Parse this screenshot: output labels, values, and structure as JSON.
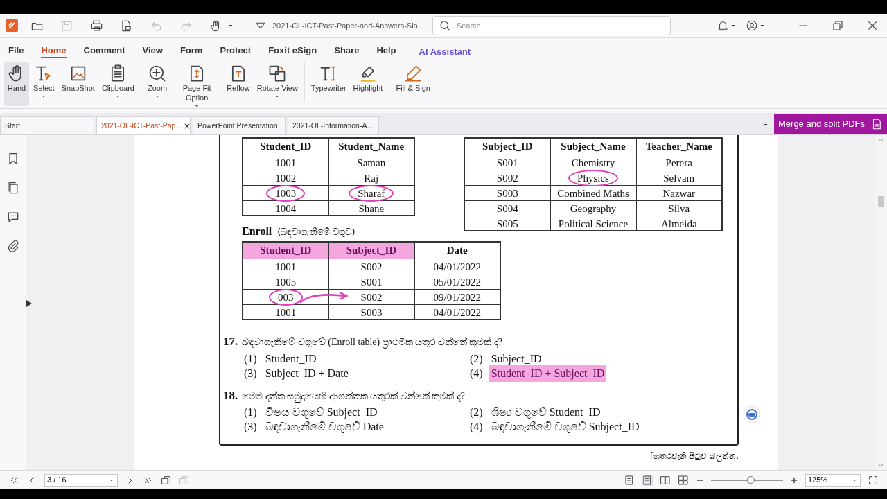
{
  "title_bar": {
    "file_title": "2021-OL-ICT-Past-Paper-and-Answers-Sin...",
    "search": {
      "placeholder": "Search"
    }
  },
  "menu": [
    {
      "label": "File",
      "selected": false
    },
    {
      "label": "Home",
      "selected": true
    },
    {
      "label": "Comment",
      "selected": false
    },
    {
      "label": "View",
      "selected": false
    },
    {
      "label": "Form",
      "selected": false
    },
    {
      "label": "Protect",
      "selected": false
    },
    {
      "label": "Foxit eSign",
      "selected": false
    },
    {
      "label": "Share",
      "selected": false
    },
    {
      "label": "Help",
      "selected": false
    },
    {
      "label": "AI Assistant",
      "selected": false,
      "kind": "accent"
    }
  ],
  "ribbon": [
    {
      "label": "Hand",
      "selected": true,
      "dropdown": false
    },
    {
      "label": "Select",
      "selected": false,
      "dropdown": true
    },
    {
      "label": "SnapShot",
      "selected": false,
      "dropdown": false
    },
    {
      "label": "Clipboard",
      "selected": false,
      "dropdown": true
    },
    {
      "label": "Zoom",
      "selected": false,
      "dropdown": true
    },
    {
      "label": "Page Fit Option",
      "selected": false,
      "dropdown": true
    },
    {
      "label": "Reflow",
      "selected": false,
      "dropdown": false
    },
    {
      "label": "Rotate View",
      "selected": false,
      "dropdown": true
    },
    {
      "label": "Typewriter",
      "selected": false,
      "dropdown": false
    },
    {
      "label": "Highlight",
      "selected": false,
      "dropdown": false
    },
    {
      "label": "Fill & Sign",
      "selected": false,
      "dropdown": false
    }
  ],
  "doc_tabs": [
    {
      "label": "Start",
      "selected": false,
      "closable": false
    },
    {
      "label": "2021-OL-ICT-Past-Pap...",
      "selected": true,
      "closable": true
    },
    {
      "label": "PowerPoint Presentation",
      "selected": false,
      "closable": false
    },
    {
      "label": "2021-OL-Information-A...",
      "selected": false,
      "closable": false
    }
  ],
  "promo_button": "Merge and split PDFs",
  "document": {
    "student_table": {
      "columns": [
        {
          "label": "Student_ID",
          "highlighted": false
        },
        {
          "label": "Student_Name",
          "highlighted": false
        }
      ],
      "rows": [
        [
          {
            "text": "1001",
            "circled": false
          },
          {
            "text": "Saman",
            "circled": false
          }
        ],
        [
          {
            "text": "1002",
            "circled": false
          },
          {
            "text": "Raj",
            "circled": false
          }
        ],
        [
          {
            "text": "1003",
            "circled": true
          },
          {
            "text": "Sharaf",
            "circled": true
          }
        ],
        [
          {
            "text": "1004",
            "circled": false
          },
          {
            "text": "Shane",
            "circled": false
          }
        ]
      ]
    },
    "subject_table": {
      "columns": [
        {
          "label": "Subject_ID",
          "highlighted": false
        },
        {
          "label": "Subject_Name",
          "highlighted": false
        },
        {
          "label": "Teacher_Name",
          "highlighted": false
        }
      ],
      "rows": [
        [
          {
            "text": "S001",
            "circled": false
          },
          {
            "text": "Chemistry",
            "circled": false
          },
          {
            "text": "Perera",
            "circled": false
          }
        ],
        [
          {
            "text": "S002",
            "circled": false
          },
          {
            "text": "Physics",
            "circled": true
          },
          {
            "text": "Selvam",
            "circled": false
          }
        ],
        [
          {
            "text": "S003",
            "circled": false
          },
          {
            "text": "Combined Maths",
            "circled": false
          },
          {
            "text": "Nazwar",
            "circled": false
          }
        ],
        [
          {
            "text": "S004",
            "circled": false
          },
          {
            "text": "Geography",
            "circled": false
          },
          {
            "text": "Silva",
            "circled": false
          }
        ],
        [
          {
            "text": "S005",
            "circled": false
          },
          {
            "text": "Political Science",
            "circled": false
          },
          {
            "text": "Almeida",
            "circled": false
          }
        ]
      ]
    },
    "enroll_title": "Enroll",
    "enroll_subtitle": "(බඳවාගැනීමේ වගුව)",
    "enroll_table": {
      "columns": [
        {
          "label": "Student_ID",
          "highlighted": true
        },
        {
          "label": "Subject_ID",
          "highlighted": true
        },
        {
          "label": "Date",
          "highlighted": false
        }
      ],
      "rows": [
        [
          {
            "text": "1001",
            "circled": false
          },
          {
            "text": "S002",
            "circled": false
          },
          {
            "text": "04/01/2022",
            "circled": false
          }
        ],
        [
          {
            "text": "1005",
            "circled": false
          },
          {
            "text": "S001",
            "circled": false
          },
          {
            "text": "05/01/2022",
            "circled": false
          }
        ],
        [
          {
            "text": "003",
            "circled": true
          },
          {
            "text": "S002",
            "circled": false
          },
          {
            "text": "09/01/2022",
            "circled": false
          }
        ],
        [
          {
            "text": "1001",
            "circled": false
          },
          {
            "text": "S003",
            "circled": false
          },
          {
            "text": "04/01/2022",
            "circled": false
          }
        ]
      ]
    },
    "questions": [
      {
        "number": "17.",
        "text": "බඳවාගැනීමේ වගුවේ (Enroll table) ප්‍රාථමික යතුර වන්නේ කුමක් ද?",
        "options": [
          {
            "number": "(1)",
            "text": "Student_ID",
            "highlighted": false
          },
          {
            "number": "(2)",
            "text": "Subject_ID",
            "highlighted": false
          },
          {
            "number": "(3)",
            "text": "Subject_ID + Date",
            "highlighted": false
          },
          {
            "number": "(4)",
            "text": "Student_ID + Subject_ID",
            "highlighted": true
          }
        ]
      },
      {
        "number": "18.",
        "text": "මෙම දත්ත සමුදායෙහි ආගන්තුක යතුරක් වන්නේ කුමක් ද?",
        "options": [
          {
            "number": "(1)",
            "text": "විෂය වගුවේ Subject_ID",
            "highlighted": false
          },
          {
            "number": "(2)",
            "text": "ශිෂ්‍ය වගුවේ Student_ID",
            "highlighted": false
          },
          {
            "number": "(3)",
            "text": "බඳවාගැනීමේ වගුවේ Date",
            "highlighted": false
          },
          {
            "number": "(4)",
            "text": "බඳවාගැනීමේ වගුවේ Subject_ID",
            "highlighted": false
          }
        ]
      }
    ],
    "footer_note": "[හතරවැනි පිටුව බලන්න."
  },
  "status_bar": {
    "page": "3 / 16",
    "zoom": "125%",
    "zoom_slider": {
      "level": 0.55
    }
  }
}
